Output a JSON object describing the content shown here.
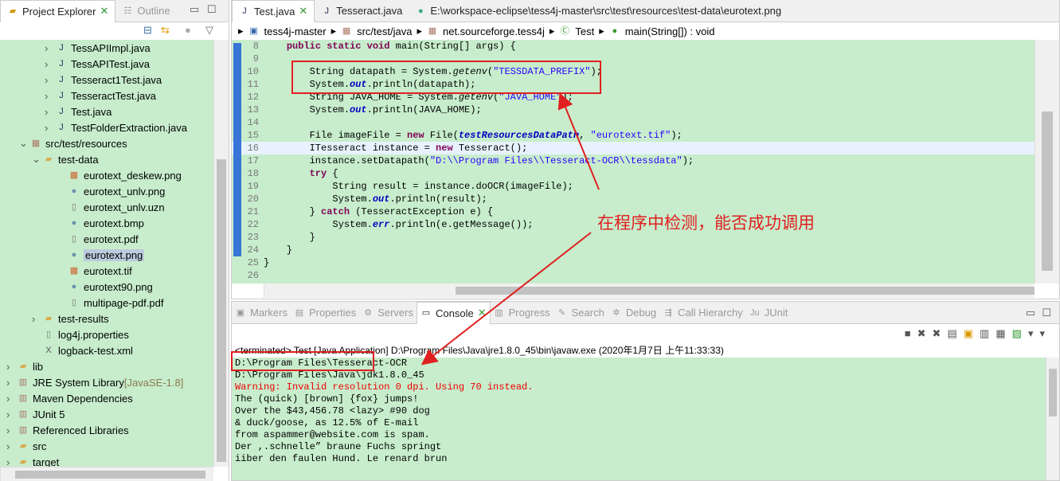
{
  "left_panel": {
    "tabs": [
      {
        "label": "Project Explorer",
        "icon": "folder-icon",
        "active": true
      },
      {
        "label": "Outline",
        "icon": "outline-icon",
        "active": false
      }
    ],
    "tree": [
      {
        "label": "TessAPIImpl.java",
        "indent": 4,
        "icon": "java-file-icon",
        "exp": ">"
      },
      {
        "label": "TessAPITest.java",
        "indent": 4,
        "icon": "java-file-icon",
        "exp": ">"
      },
      {
        "label": "Tesseract1Test.java",
        "indent": 4,
        "icon": "java-file-icon",
        "exp": ">"
      },
      {
        "label": "TesseractTest.java",
        "indent": 4,
        "icon": "java-file-icon",
        "exp": ">"
      },
      {
        "label": "Test.java",
        "indent": 4,
        "icon": "java-file-icon",
        "exp": ">"
      },
      {
        "label": "TestFolderExtraction.java",
        "indent": 4,
        "icon": "java-file-icon",
        "exp": ">"
      },
      {
        "label": "src/test/resources",
        "indent": 2,
        "icon": "source-folder-icon",
        "exp": "v"
      },
      {
        "label": "test-data",
        "indent": 3,
        "icon": "folder-icon",
        "exp": "v"
      },
      {
        "label": "eurotext_deskew.png",
        "indent": 5,
        "icon": "image-file-icon",
        "exp": ""
      },
      {
        "label": "eurotext_unlv.png",
        "indent": 5,
        "icon": "globe-file-icon",
        "exp": ""
      },
      {
        "label": "eurotext_unlv.uzn",
        "indent": 5,
        "icon": "text-file-icon",
        "exp": ""
      },
      {
        "label": "eurotext.bmp",
        "indent": 5,
        "icon": "globe-file-icon",
        "exp": ""
      },
      {
        "label": "eurotext.pdf",
        "indent": 5,
        "icon": "text-file-icon",
        "exp": ""
      },
      {
        "label": "eurotext.png",
        "indent": 5,
        "icon": "globe-file-icon",
        "exp": "",
        "selected": true
      },
      {
        "label": "eurotext.tif",
        "indent": 5,
        "icon": "image-file-icon",
        "exp": ""
      },
      {
        "label": "eurotext90.png",
        "indent": 5,
        "icon": "globe-file-icon",
        "exp": ""
      },
      {
        "label": "multipage-pdf.pdf",
        "indent": 5,
        "icon": "text-file-icon",
        "exp": ""
      },
      {
        "label": "test-results",
        "indent": 3,
        "icon": "folder-icon",
        "exp": ">"
      },
      {
        "label": "log4j.properties",
        "indent": 3,
        "icon": "text-file-icon",
        "exp": ""
      },
      {
        "label": "logback-test.xml",
        "indent": 3,
        "icon": "xml-file-icon",
        "exp": ""
      },
      {
        "label": "lib",
        "indent": 1,
        "icon": "folder-icon",
        "exp": ">"
      },
      {
        "label": "JRE System Library",
        "suffix": " [JavaSE-1.8]",
        "indent": 1,
        "icon": "library-icon",
        "exp": ">"
      },
      {
        "label": "Maven Dependencies",
        "indent": 1,
        "icon": "library-icon",
        "exp": ">"
      },
      {
        "label": "JUnit 5",
        "indent": 1,
        "icon": "library-icon",
        "exp": ">"
      },
      {
        "label": "Referenced Libraries",
        "indent": 1,
        "icon": "library-icon",
        "exp": ">"
      },
      {
        "label": "src",
        "indent": 1,
        "icon": "folder-icon",
        "exp": ">"
      },
      {
        "label": "target",
        "indent": 1,
        "icon": "folder-icon",
        "exp": ">"
      }
    ]
  },
  "editor": {
    "tabs": [
      {
        "label": "Test.java",
        "active": true,
        "icon": "java-file-icon"
      },
      {
        "label": "Tesseract.java",
        "active": false,
        "icon": "java-file-icon"
      },
      {
        "label": "E:\\workspace-eclipse\\tess4j-master\\src\\test\\resources\\test-data\\eurotext.png",
        "active": false,
        "icon": "globe-icon"
      }
    ],
    "breadcrumb": [
      "tess4j-master",
      "src/test/java",
      "net.sourceforge.tess4j",
      "Test",
      "main(String[]) : void"
    ],
    "lines": [
      {
        "n": "8",
        "t": [
          [
            "    "
          ],
          [
            "public static void",
            "kw"
          ],
          [
            " main(String[] args) {"
          ]
        ]
      },
      {
        "n": "9",
        "t": [
          [
            ""
          ]
        ]
      },
      {
        "n": "10",
        "t": [
          [
            "        String datapath = System."
          ],
          [
            "getenv",
            "it"
          ],
          [
            "("
          ],
          [
            "\"TESSDATA_PREFIX\"",
            "st"
          ],
          [
            ");"
          ]
        ]
      },
      {
        "n": "11",
        "t": [
          [
            "        System."
          ],
          [
            "out",
            "fd"
          ],
          [
            ".println(datapath);"
          ]
        ]
      },
      {
        "n": "12",
        "t": [
          [
            "        String JAVA_HOME = System."
          ],
          [
            "getenv",
            "it"
          ],
          [
            "("
          ],
          [
            "\"JAVA_HOME\"",
            "st"
          ],
          [
            ");"
          ]
        ]
      },
      {
        "n": "13",
        "t": [
          [
            "        System."
          ],
          [
            "out",
            "fd"
          ],
          [
            ".println(JAVA_HOME);"
          ]
        ]
      },
      {
        "n": "14",
        "t": [
          [
            ""
          ]
        ]
      },
      {
        "n": "15",
        "t": [
          [
            "        File imageFile = "
          ],
          [
            "new",
            "kw"
          ],
          [
            " File("
          ],
          [
            "testResourcesDataPath",
            "fd"
          ],
          [
            ", "
          ],
          [
            "\"eurotext.tif\"",
            "st"
          ],
          [
            ");"
          ]
        ]
      },
      {
        "n": "16",
        "t": [
          [
            "        ITesseract instance = "
          ],
          [
            "new",
            "kw"
          ],
          [
            " Tesseract();"
          ]
        ],
        "current": true
      },
      {
        "n": "17",
        "t": [
          [
            "        instance.setDatapath("
          ],
          [
            "\"D:\\\\Program Files\\\\Tesseract-OCR\\\\tessdata\"",
            "st"
          ],
          [
            ");"
          ]
        ]
      },
      {
        "n": "18",
        "t": [
          [
            "        "
          ],
          [
            "try",
            "kw"
          ],
          [
            " {"
          ]
        ]
      },
      {
        "n": "19",
        "t": [
          [
            "            String result = instance.doOCR(imageFile);"
          ]
        ]
      },
      {
        "n": "20",
        "t": [
          [
            "            System."
          ],
          [
            "out",
            "fd"
          ],
          [
            ".println(result);"
          ]
        ]
      },
      {
        "n": "21",
        "t": [
          [
            "        } "
          ],
          [
            "catch",
            "kw"
          ],
          [
            " (TesseractException e) {"
          ]
        ]
      },
      {
        "n": "22",
        "t": [
          [
            "            System."
          ],
          [
            "err",
            "fd"
          ],
          [
            ".println(e.getMessage());"
          ]
        ]
      },
      {
        "n": "23",
        "t": [
          [
            "        }"
          ]
        ]
      },
      {
        "n": "24",
        "t": [
          [
            "    }"
          ]
        ]
      },
      {
        "n": "25",
        "t": [
          [
            "}"
          ]
        ]
      },
      {
        "n": "26",
        "t": [
          [
            ""
          ]
        ]
      }
    ]
  },
  "bottom": {
    "tabs": [
      {
        "label": "Markers",
        "active": false
      },
      {
        "label": "Properties",
        "active": false
      },
      {
        "label": "Servers",
        "active": false
      },
      {
        "label": "Console",
        "active": true
      },
      {
        "label": "Progress",
        "active": false
      },
      {
        "label": "Search",
        "active": false
      },
      {
        "label": "Debug",
        "active": false
      },
      {
        "label": "Call Hierarchy",
        "active": false
      },
      {
        "label": "JUnit",
        "active": false
      }
    ],
    "status": "<terminated> Test [Java Application] D:\\Program Files\\Java\\jre1.8.0_45\\bin\\javaw.exe (2020年1月7日 上午11:33:33)",
    "output": [
      {
        "text": "D:\\Program Files\\Tesseract-OCR",
        "err": false
      },
      {
        "text": "D:\\Program Files\\Java\\jdk1.8.0_45",
        "err": false
      },
      {
        "text": "Warning: Invalid resolution 0 dpi. Using 70 instead.",
        "err": true
      },
      {
        "text": "The (quick) [brown] {fox} jumps!",
        "err": false
      },
      {
        "text": "Over the $43,456.78 <lazy> #90 dog",
        "err": false
      },
      {
        "text": "& duck/goose, as 12.5% of E-mail",
        "err": false
      },
      {
        "text": "from aspammer@website.com is spam.",
        "err": false
      },
      {
        "text": "Der ,.schnelle” braune Fuchs springt",
        "err": false
      },
      {
        "text": "iiber den faulen Hund. Le renard brun",
        "err": false
      }
    ]
  },
  "annotation": {
    "text": "在程序中检测，能否成功调用",
    "color": "#e02020"
  },
  "colors": {
    "editor_bg": "#c7edcc",
    "keyword": "#7f0055",
    "string": "#2a00ff",
    "error": "#ff0000"
  }
}
